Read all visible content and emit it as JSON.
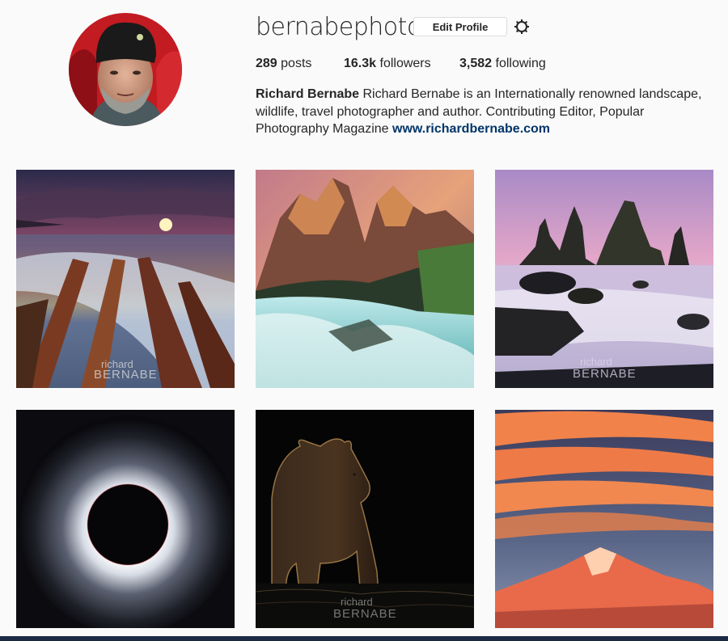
{
  "profile": {
    "username": "bernabephoto",
    "edit_label": "Edit Profile",
    "stats": {
      "posts_value": "289",
      "posts_label": "posts",
      "followers_value": "16.3k",
      "followers_label": "followers",
      "following_value": "3,582",
      "following_label": "following"
    },
    "bio": {
      "name": "Richard Bernabe",
      "text": "Richard Bernabe is an Internationally renowned landscape, wildlife, travel photographer and author. Contributing Editor, Popular Photography Magazine",
      "link": "www.richardbernabe.com"
    }
  },
  "icons": {
    "settings": "gear-icon",
    "avatar": "profile-photo"
  },
  "watermark": {
    "line1": "richard",
    "line2": "BERNABE"
  },
  "grid": {
    "posts": [
      {
        "subject": "sunset-coast"
      },
      {
        "subject": "mountain-waterfall"
      },
      {
        "subject": "sea-stacks"
      },
      {
        "subject": "solar-eclipse"
      },
      {
        "subject": "bear-silhouette"
      },
      {
        "subject": "lenticular-clouds-mountain"
      }
    ]
  },
  "colors": {
    "link": "#003569",
    "border": "#dbdbdb",
    "background": "#fafafa"
  }
}
